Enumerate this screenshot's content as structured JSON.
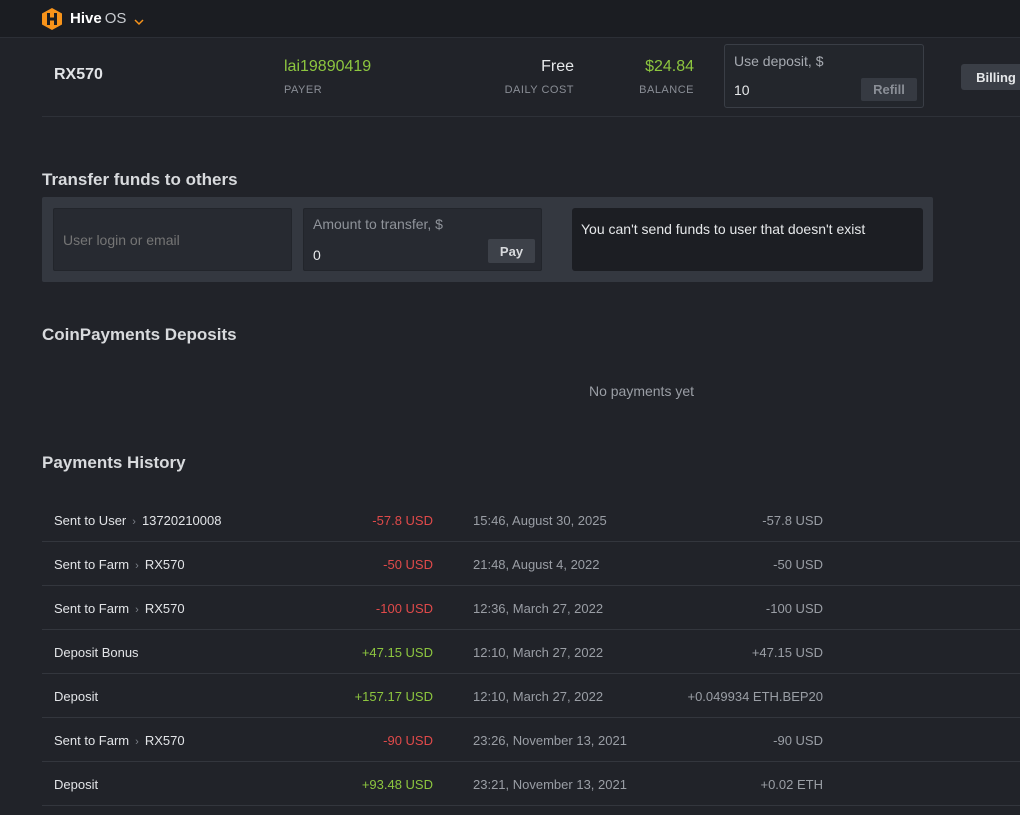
{
  "header": {
    "brand": "Hive",
    "brand_suffix": "OS",
    "accent": "#f7931a"
  },
  "farm": {
    "name": "RX570",
    "payer_value": "lai19890419",
    "payer_label": "PAYER",
    "daily_cost_value": "Free",
    "daily_cost_label": "DAILY COST",
    "balance_value": "$24.84",
    "balance_label": "BALANCE",
    "deposit_label": "Use deposit, $",
    "deposit_value": "10",
    "refill_label": "Refill",
    "billing_label": "Billing"
  },
  "transfer": {
    "title": "Transfer funds to others",
    "login_placeholder": "User login or email",
    "amount_label": "Amount to transfer, $",
    "amount_value": "0",
    "pay_label": "Pay",
    "message": "You can't send funds to user that doesn't exist"
  },
  "coinpayments": {
    "title": "CoinPayments Deposits",
    "empty_text": "No payments yet"
  },
  "history": {
    "title": "Payments History",
    "rows": [
      {
        "desc": "Sent to User",
        "target": "13720210008",
        "amount": "-57.8 USD",
        "sign": "neg",
        "date": "15:46, August 30, 2025",
        "original": "-57.8 USD"
      },
      {
        "desc": "Sent to Farm",
        "target": "RX570",
        "amount": "-50 USD",
        "sign": "neg",
        "date": "21:48, August 4, 2022",
        "original": "-50 USD"
      },
      {
        "desc": "Sent to Farm",
        "target": "RX570",
        "amount": "-100 USD",
        "sign": "neg",
        "date": "12:36, March 27, 2022",
        "original": "-100 USD"
      },
      {
        "desc": "Deposit Bonus",
        "target": "",
        "amount": "+47.15 USD",
        "sign": "pos",
        "date": "12:10, March 27, 2022",
        "original": "+47.15 USD"
      },
      {
        "desc": "Deposit",
        "target": "",
        "amount": "+157.17 USD",
        "sign": "pos",
        "date": "12:10, March 27, 2022",
        "original": "+0.049934 ETH.BEP20"
      },
      {
        "desc": "Sent to Farm",
        "target": "RX570",
        "amount": "-90 USD",
        "sign": "neg",
        "date": "23:26, November 13, 2021",
        "original": "-90 USD"
      },
      {
        "desc": "Deposit",
        "target": "",
        "amount": "+93.48 USD",
        "sign": "pos",
        "date": "23:21, November 13, 2021",
        "original": "+0.02 ETH"
      }
    ]
  }
}
